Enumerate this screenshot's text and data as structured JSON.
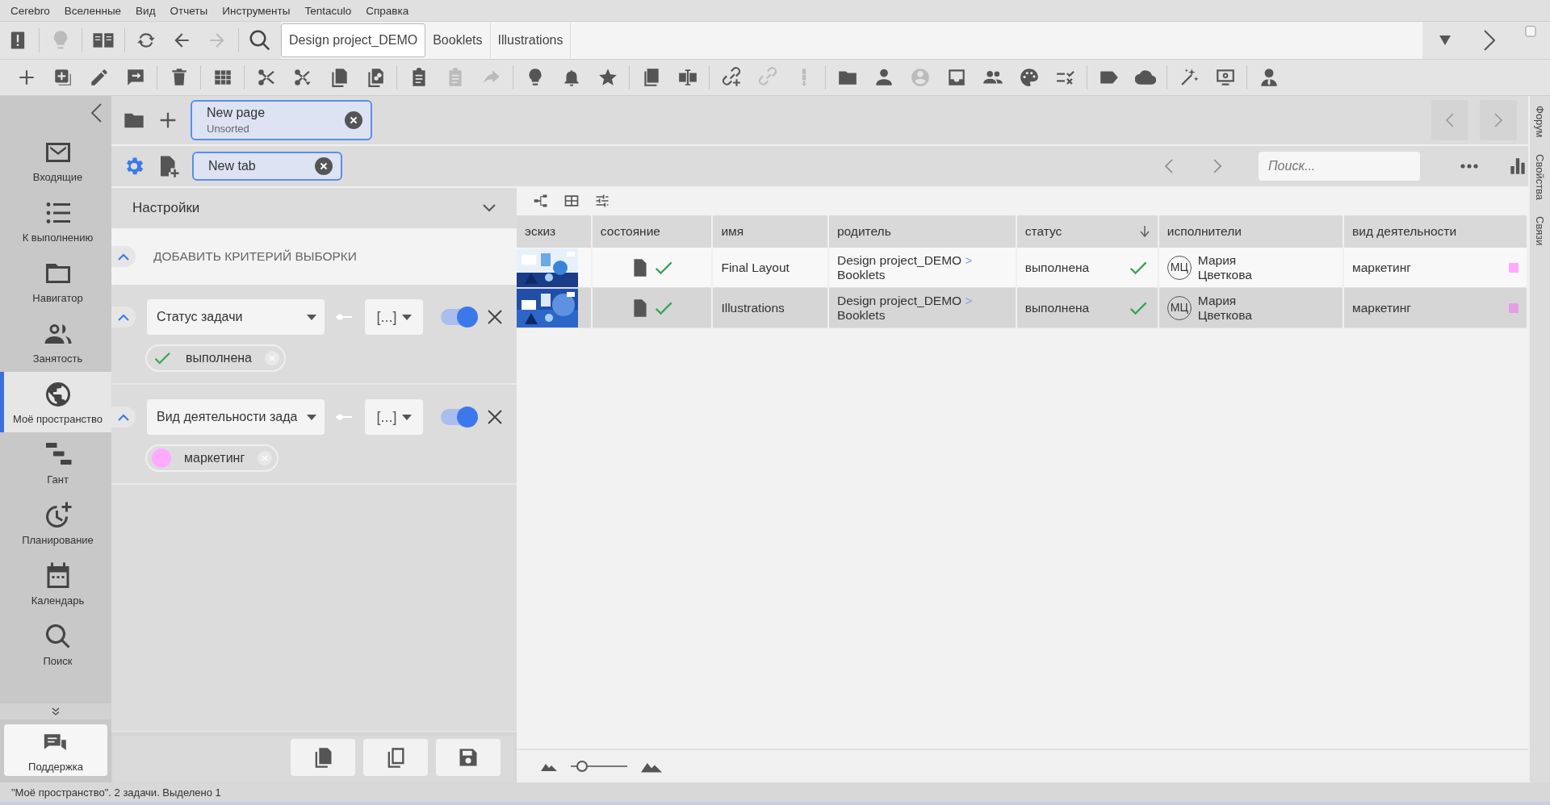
{
  "menu": [
    "Cerebro",
    "Вселенные",
    "Вид",
    "Отчеты",
    "Инструменты",
    "Tentaculo",
    "Справка"
  ],
  "toolbar": {
    "tabs": [
      {
        "label": "Design project_DEMO",
        "selected": true
      },
      {
        "label": "Booklets",
        "selected": false
      },
      {
        "label": "Illustrations",
        "selected": false
      }
    ]
  },
  "sidebar": {
    "items": [
      {
        "label": "Входящие",
        "selected": false
      },
      {
        "label": "К выполнению",
        "selected": false
      },
      {
        "label": "Навигатор",
        "selected": false
      },
      {
        "label": "Занятость",
        "selected": false
      },
      {
        "label": "Моё пространство",
        "selected": true
      },
      {
        "label": "Гант",
        "selected": false
      },
      {
        "label": "Планирование",
        "selected": false
      },
      {
        "label": "Календарь",
        "selected": false
      },
      {
        "label": "Поиск",
        "selected": false
      }
    ],
    "support": "Поддержка"
  },
  "page_tabs": [
    {
      "title": "New page",
      "subtitle": "Unsorted"
    }
  ],
  "view_tabs": [
    {
      "label": "New tab"
    }
  ],
  "search": {
    "placeholder": "Поиск..."
  },
  "filter": {
    "title": "Настройки",
    "add_criterion": "ДОБАВИТЬ КРИТЕРИЙ ВЫБОРКИ",
    "criteria": [
      {
        "field": "Статус задачи",
        "operator": "[...]",
        "on": true,
        "values": [
          {
            "label": "выполнена",
            "kind": "check"
          }
        ]
      },
      {
        "field": "Вид деятельности зада",
        "operator": "[...]",
        "on": true,
        "values": [
          {
            "label": "маркетинг",
            "kind": "color",
            "color": "#ffaaff"
          }
        ]
      }
    ]
  },
  "table": {
    "columns": [
      {
        "label": "эскиз",
        "sorted": false
      },
      {
        "label": "состояние",
        "sorted": false
      },
      {
        "label": "имя",
        "sorted": false
      },
      {
        "label": "родитель",
        "sorted": false
      },
      {
        "label": "статус",
        "sorted": true
      },
      {
        "label": "исполнители",
        "sorted": false
      },
      {
        "label": "вид деятельности",
        "sorted": false
      }
    ],
    "rows": [
      {
        "selected": false,
        "state_done": true,
        "name": "Final Layout",
        "parent": "Design project_DEMO",
        "parent_separator": ">",
        "parent_child": "Booklets",
        "status": "выполнена",
        "done": true,
        "assignee_initials": "МЦ",
        "assignee": "Мария Цветкова",
        "activity": "маркетинг",
        "color": "#ffaaff"
      },
      {
        "selected": true,
        "state_done": true,
        "name": "Illustrations",
        "parent": "Design project_DEMO",
        "parent_separator": ">",
        "parent_child": "Booklets",
        "status": "выполнена",
        "done": true,
        "assignee_initials": "МЦ",
        "assignee": "Мария Цветкова",
        "activity": "маркетинг",
        "color": "#e59ee5"
      }
    ]
  },
  "thumbnail_zoom": {
    "level": 0.2
  },
  "side_tabs": [
    "Форум",
    "Свойства",
    "Связи"
  ],
  "status_bar": "\"Моё пространство\". 2 задачи. Выделено 1"
}
